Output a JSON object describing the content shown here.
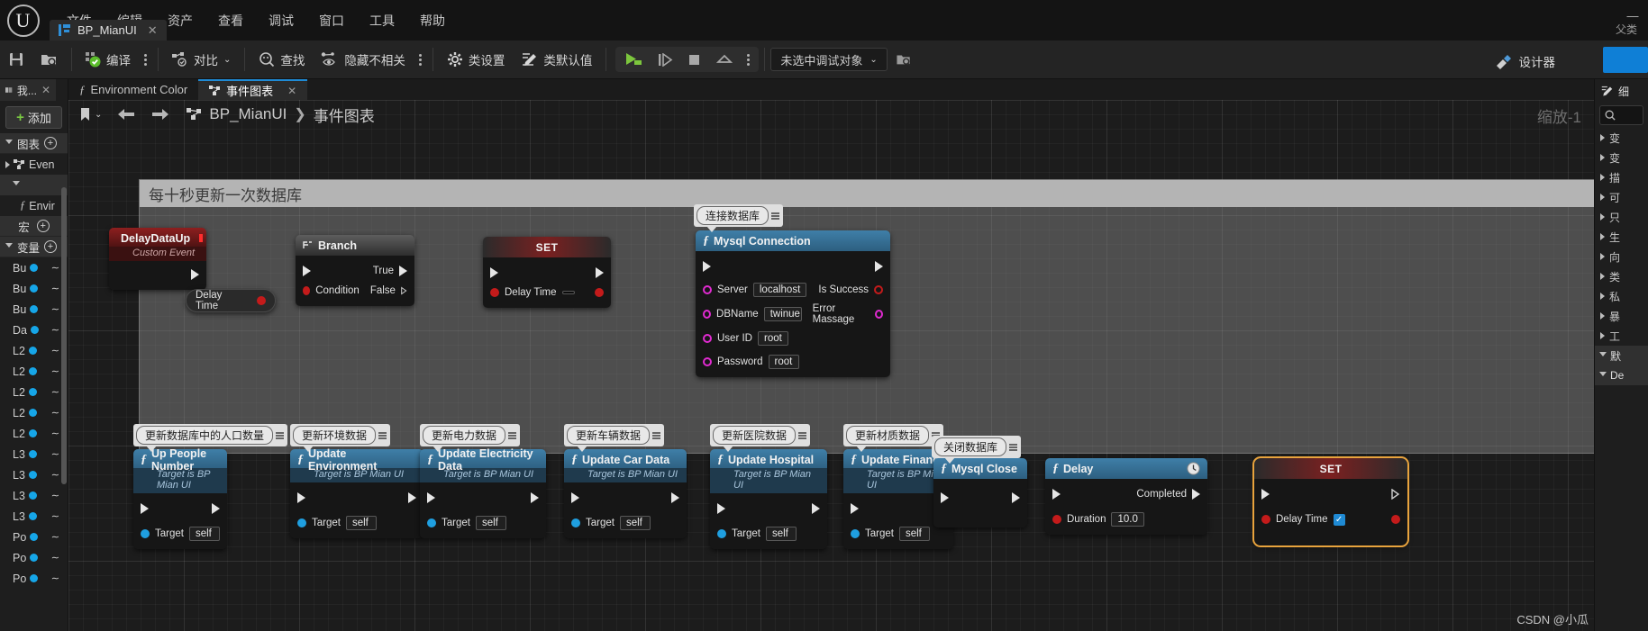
{
  "app": {
    "logo": "ue-logo",
    "menu": [
      "文件",
      "编辑",
      "资产",
      "查看",
      "调试",
      "窗口",
      "工具",
      "帮助"
    ],
    "parent_label": "父类",
    "minimize": "—"
  },
  "asset_tab": {
    "title": "BP_MianUI",
    "close": "✕"
  },
  "toolbar": {
    "save_label": "",
    "browse_label": "",
    "compile_label": "编译",
    "diff_label": "对比",
    "find_label": "查找",
    "hide_unrelated_label": "隐藏不相关",
    "class_settings_label": "类设置",
    "class_defaults_label": "类默认值",
    "debug_object": "未选中调试对象",
    "designer_label": "设计器"
  },
  "left_panel": {
    "tab_label": "我...",
    "tab_close": "✕",
    "add_label": "添加",
    "sections": [
      {
        "label": "图表",
        "has_add": true
      },
      {
        "label": "宏",
        "has_add": true
      },
      {
        "label": "变量",
        "has_add": true
      }
    ],
    "graph_item": "Even",
    "function_item": "Envir",
    "variables": [
      "Bu",
      "Bu",
      "Bu",
      "Da",
      "L2",
      "L2",
      "L2",
      "L2",
      "L2",
      "L3",
      "L3",
      "L3",
      "L3",
      "Po",
      "Po",
      "Po"
    ]
  },
  "graph_tabs": [
    {
      "label": "Environment Color",
      "icon": "function-icon",
      "active": false,
      "closable": false
    },
    {
      "label": "事件图表",
      "icon": "graph-icon",
      "active": true,
      "closable": true
    }
  ],
  "graph_toolbar": {
    "bookmark_icon": "bookmark-icon",
    "back_icon": "arrow-left-icon",
    "forward_icon": "arrow-right-icon",
    "breadcrumb_root": "BP_MianUI",
    "breadcrumb_sep": "❯",
    "breadcrumb_current": "事件图表",
    "zoom_label": "缩放-1"
  },
  "comment_box": {
    "title": "每十秒更新一次数据库"
  },
  "nodes": {
    "custom_event": {
      "title": "DelayDataUp",
      "subtitle": "Custom Event"
    },
    "branch": {
      "title": "Branch",
      "true_label": "True",
      "false_label": "False",
      "condition_label": "Condition"
    },
    "delay_time_get": {
      "title": "Delay Time"
    },
    "set_node": {
      "title": "SET",
      "pin_label": "Delay Time",
      "value": ""
    },
    "mysql_connection": {
      "title": "Mysql Connection",
      "bubble": "连接数据库",
      "inputs": [
        {
          "label": "Server",
          "value": "localhost"
        },
        {
          "label": "DBName",
          "value": "twinue"
        },
        {
          "label": "User ID",
          "value": "root"
        },
        {
          "label": "Password",
          "value": "root"
        }
      ],
      "outputs": [
        {
          "label": "Is Success"
        },
        {
          "label": "Error Massage"
        }
      ]
    },
    "bottom_row": [
      {
        "bubble": "更新数据库中的人口数量",
        "title": "Up People Number",
        "subtitle": "Target is BP Mian UI",
        "target_label": "Target",
        "target_value": "self"
      },
      {
        "bubble": "更新环境数据",
        "title": "Update Environment",
        "subtitle": "Target is BP Mian UI",
        "target_label": "Target",
        "target_value": "self"
      },
      {
        "bubble": "更新电力数据",
        "title": "Update Electricity Data",
        "subtitle": "Target is BP Mian UI",
        "target_label": "Target",
        "target_value": "self"
      },
      {
        "bubble": "更新车辆数据",
        "title": "Update Car Data",
        "subtitle": "Target is BP Mian UI",
        "target_label": "Target",
        "target_value": "self"
      },
      {
        "bubble": "更新医院数据",
        "title": "Update Hospital",
        "subtitle": "Target is BP Mian UI",
        "target_label": "Target",
        "target_value": "self"
      },
      {
        "bubble": "更新材质数据",
        "title": "Update Finance",
        "subtitle": "Target is BP Mian UI",
        "target_label": "Target",
        "target_value": "self"
      }
    ],
    "mysql_close": {
      "bubble": "关闭数据库",
      "title": "Mysql Close"
    },
    "delay": {
      "title": "Delay",
      "completed_label": "Completed",
      "duration_label": "Duration",
      "duration_value": "10.0"
    },
    "set_node2": {
      "title": "SET",
      "pin_label": "Delay Time",
      "checked": true
    }
  },
  "right_panel": {
    "details_label": "细",
    "search_placeholder": "",
    "rows": [
      "变",
      "变",
      "描",
      "可",
      "只",
      "生",
      "向",
      "类",
      "私",
      "暴",
      "工"
    ],
    "sections": [
      "默",
      "De"
    ]
  },
  "watermark": "CSDN @小瓜"
}
